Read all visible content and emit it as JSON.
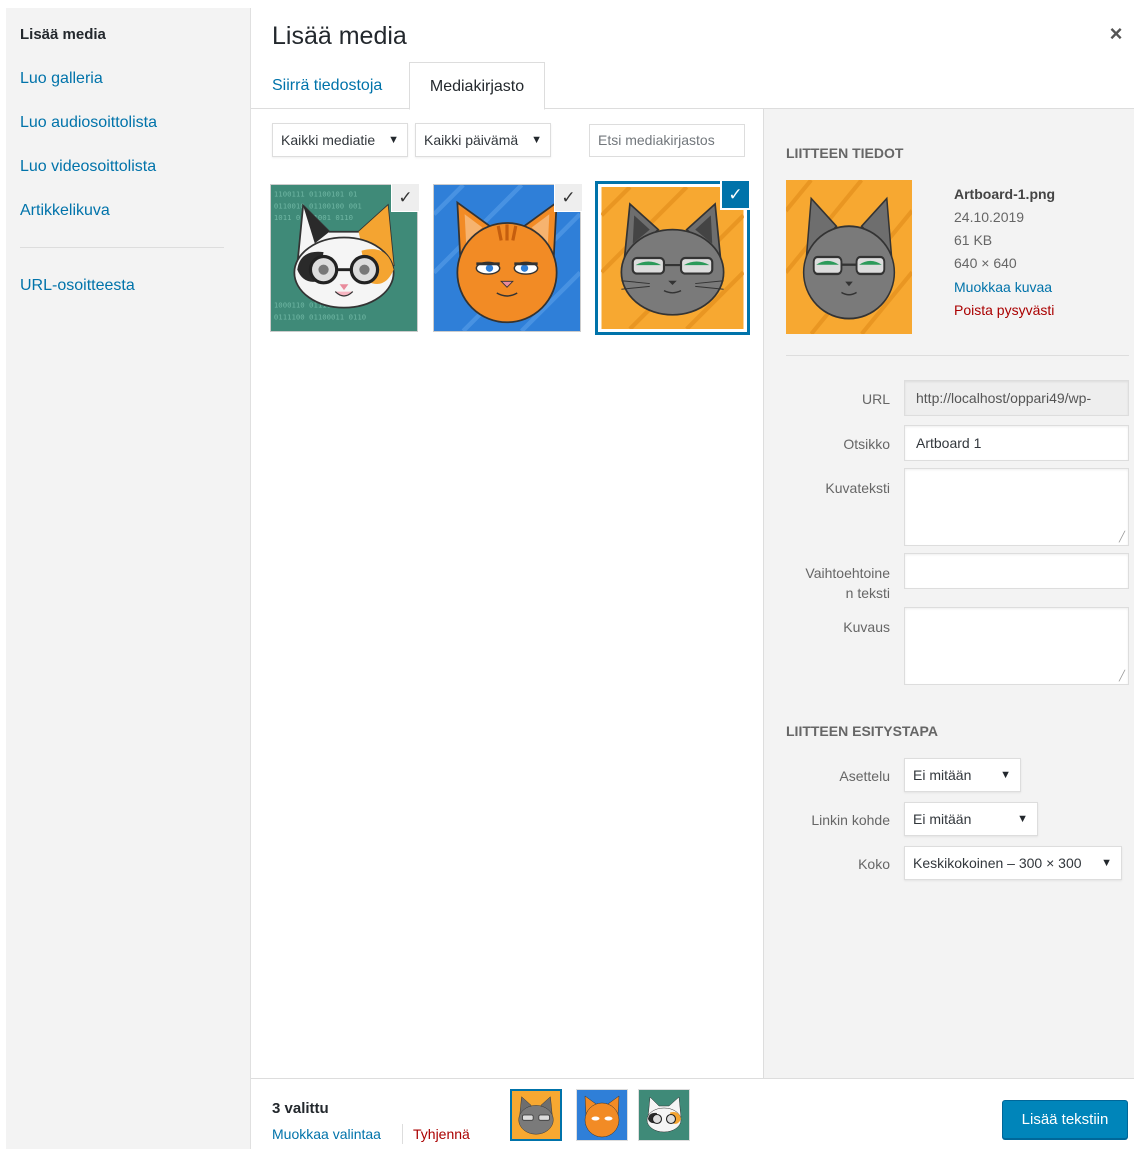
{
  "sidebar": {
    "items": [
      {
        "label": "Lisää media",
        "active": true
      },
      {
        "label": "Luo galleria"
      },
      {
        "label": "Luo audiosoittolista"
      },
      {
        "label": "Luo videosoittolista"
      },
      {
        "label": "Artikkelikuva"
      },
      {
        "label": "URL-osoitteesta"
      }
    ]
  },
  "header": {
    "title": "Lisää media",
    "close_icon": "×"
  },
  "tabs": [
    {
      "label": "Siirrä tiedostoja"
    },
    {
      "label": "Mediakirjasto",
      "active": true
    }
  ],
  "toolbar": {
    "media_filter": "Kaikki mediatie",
    "date_filter": "Kaikki päivämä",
    "search_placeholder": "Etsi mediakirjastos"
  },
  "grid": {
    "items": [
      {
        "icon": "calico-cat-glasses",
        "selected": true,
        "check_icon": "✓"
      },
      {
        "icon": "orange-tabby-cat",
        "selected": true,
        "check_icon": "✓"
      },
      {
        "icon": "grey-cat-glasses",
        "selected": true,
        "current": true,
        "check_icon": "✓"
      }
    ]
  },
  "details": {
    "heading": "Liitteen tiedot",
    "filename": "Artboard-1.png",
    "date": "24.10.2019",
    "size": "61 KB",
    "dimensions": "640 × 640",
    "edit_link": "Muokkaa kuvaa",
    "delete_link": "Poista pysyvästi",
    "fields": {
      "url_label": "URL",
      "url_value": "http://localhost/oppari49/wp-",
      "title_label": "Otsikko",
      "title_value": "Artboard 1",
      "caption_label": "Kuvateksti",
      "caption_value": "",
      "alt_label_1": "Vaihtoehtoine",
      "alt_label_2": "n teksti",
      "alt_value": "",
      "description_label": "Kuvaus",
      "description_value": ""
    },
    "display_heading": "Liitteen esitystapa",
    "display": {
      "align_label": "Asettelu",
      "align_value": "Ei mitään",
      "link_label": "Linkin kohde",
      "link_value": "Ei mitään",
      "size_label": "Koko",
      "size_value": "Keskikokoinen – 300 × 300"
    }
  },
  "footer": {
    "count_text": "3 valittu",
    "edit_selection": "Muokkaa valintaa",
    "clear": "Tyhjennä",
    "insert_button": "Lisää tekstiin"
  },
  "colors": {
    "accent": "#0073aa",
    "primary_button": "#0085ba",
    "delete": "#a00",
    "sidebar_bg": "#f3f3f3"
  }
}
